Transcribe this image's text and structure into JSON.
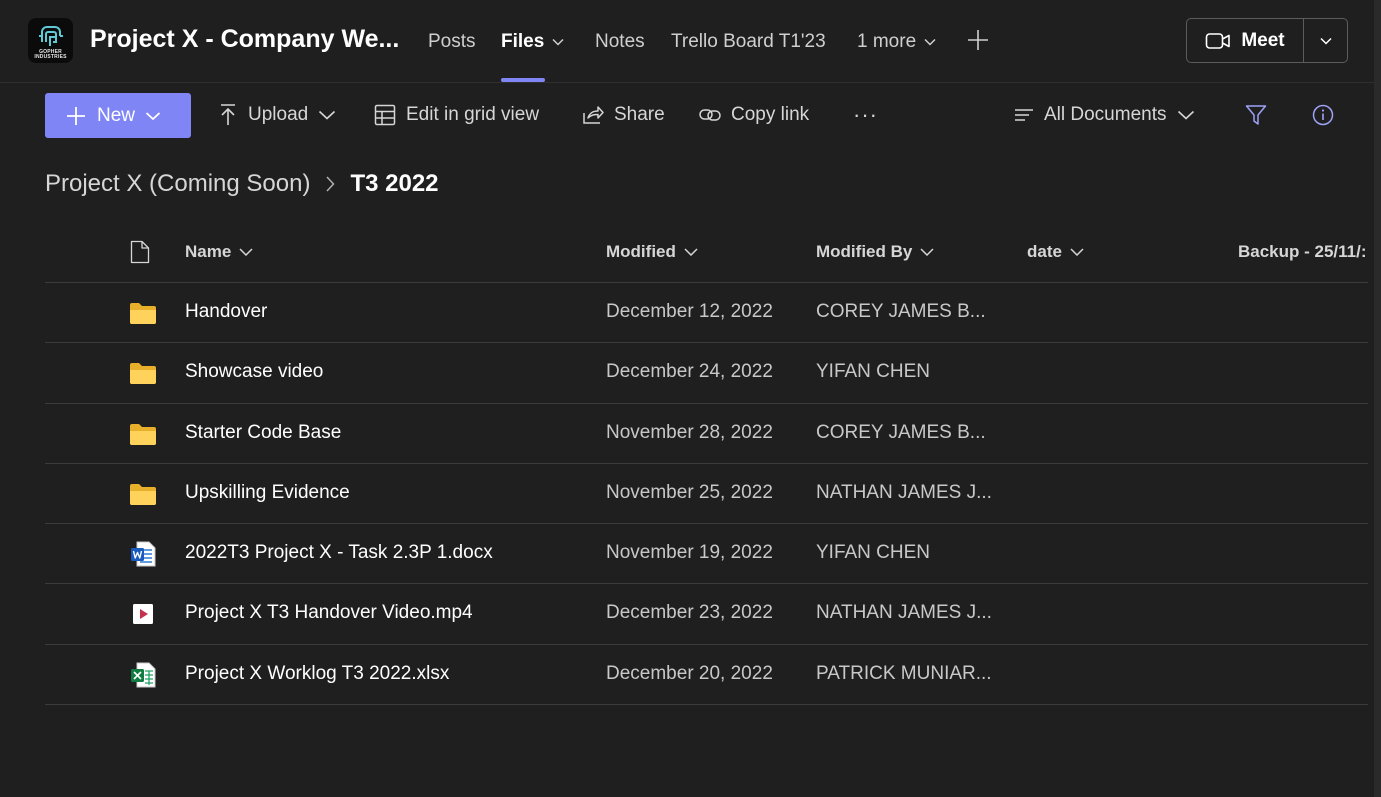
{
  "app": {
    "logo_text": "GOPHER INDUSTRIES",
    "team_title": "Project X - Company We...",
    "tabs": [
      {
        "label": "Posts",
        "active": false
      },
      {
        "label": "Files",
        "active": true
      },
      {
        "label": "Notes",
        "active": false
      },
      {
        "label": "Trello Board T1'23",
        "active": false
      },
      {
        "label": "1 more",
        "active": false
      }
    ],
    "meet_label": "Meet",
    "accent_color": "#7f85f5"
  },
  "toolbar": {
    "new_label": "New",
    "upload_label": "Upload",
    "grid_label": "Edit in grid view",
    "share_label": "Share",
    "copy_link_label": "Copy link",
    "more_label": "···",
    "view_label": "All Documents"
  },
  "breadcrumb": {
    "parent": "Project X (Coming Soon)",
    "current": "T3 2022"
  },
  "table": {
    "columns": {
      "name": "Name",
      "modified": "Modified",
      "modified_by": "Modified By",
      "date": "date",
      "backup": "Backup - 25/11/:"
    },
    "rows": [
      {
        "type": "folder",
        "name": "Handover",
        "modified": "December 12, 2022",
        "modified_by": "COREY JAMES B..."
      },
      {
        "type": "folder",
        "name": "Showcase video",
        "modified": "December 24, 2022",
        "modified_by": "YIFAN CHEN"
      },
      {
        "type": "folder",
        "name": "Starter Code Base",
        "modified": "November 28, 2022",
        "modified_by": "COREY JAMES B..."
      },
      {
        "type": "folder",
        "name": "Upskilling Evidence",
        "modified": "November 25, 2022",
        "modified_by": "NATHAN JAMES J..."
      },
      {
        "type": "word",
        "name": "2022T3 Project X - Task 2.3P 1.docx",
        "modified": "November 19, 2022",
        "modified_by": "YIFAN CHEN"
      },
      {
        "type": "video",
        "name": "Project X T3 Handover Video.mp4",
        "modified": "December 23, 2022",
        "modified_by": "NATHAN JAMES J..."
      },
      {
        "type": "excel",
        "name": "Project X Worklog T3 2022.xlsx",
        "modified": "December 20, 2022",
        "modified_by": "PATRICK MUNIAR..."
      }
    ]
  }
}
